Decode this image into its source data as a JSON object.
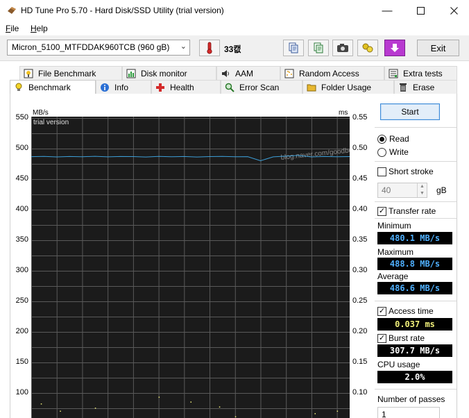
{
  "window": {
    "title": "HD Tune Pro 5.70 - Hard Disk/SSD Utility (trial version)"
  },
  "menu": {
    "file_rest": "ile",
    "help_rest": "elp",
    "file_mn": "F",
    "help_mn": "H"
  },
  "toolbar": {
    "drive": "Micron_5100_MTFDDAK960TCB (960 gB)",
    "temperature": "33캢",
    "exit_label": "Exit"
  },
  "tabs": {
    "top": [
      "File Benchmark",
      "Disk monitor",
      "AAM",
      "Random Access",
      "Extra tests"
    ],
    "bottom": [
      "Benchmark",
      "Info",
      "Health",
      "Error Scan",
      "Folder Usage",
      "Erase"
    ],
    "active": "Benchmark"
  },
  "panel": {
    "start_label": "Start",
    "read_label": "Read",
    "write_label": "Write",
    "mode_selected": "Read",
    "short_stroke_label": "Short stroke",
    "short_stroke_checked": false,
    "short_stroke_value": "40",
    "short_stroke_unit": "gB",
    "transfer_rate_label": "Transfer rate",
    "transfer_rate_checked": true,
    "minimum_label": "Minimum",
    "minimum_value": "480.1 MB/s",
    "maximum_label": "Maximum",
    "maximum_value": "488.8 MB/s",
    "average_label": "Average",
    "average_value": "486.6 MB/s",
    "access_time_label": "Access time",
    "access_time_checked": true,
    "access_time_value": "0.037 ms",
    "burst_rate_label": "Burst rate",
    "burst_rate_checked": true,
    "burst_rate_value": "307.7 MB/s",
    "cpu_usage_label": "CPU usage",
    "cpu_usage_value": "2.0%",
    "passes_label": "Number of passes",
    "passes_value": "1"
  },
  "colors": {
    "plot_bg": "#1b1b1b",
    "grid": "#5a5a5a",
    "transfer_line": "#3d9fd8",
    "value_blue": "#4fb0ff",
    "value_yellow": "#f0ef7a",
    "value_white": "#ffffff"
  },
  "chart_data": {
    "type": "line",
    "trial_label": "trial version",
    "watermark": "blog.naver.com/goodboy0505",
    "y_left_unit": "MB/s",
    "y_right_unit": "ms",
    "y_left_ticks": [
      550,
      500,
      450,
      400,
      350,
      300,
      250,
      200,
      150,
      100
    ],
    "y_right_ticks": [
      "0.55",
      "0.50",
      "0.45",
      "0.40",
      "0.35",
      "0.30",
      "0.25",
      "0.20",
      "0.15",
      "0.10"
    ],
    "ylim_left": [
      0,
      550
    ],
    "ylim_right": [
      0,
      0.55
    ],
    "grid": true,
    "series": [
      {
        "name": "Transfer rate",
        "x": [
          0,
          4,
          8,
          12,
          16,
          20,
          24,
          28,
          32,
          36,
          40,
          44,
          48,
          52,
          56,
          60,
          64,
          68,
          72,
          76,
          80,
          84,
          88,
          92,
          96,
          100
        ],
        "values": [
          486.8,
          487.2,
          486.4,
          487.0,
          486.6,
          487.4,
          486.5,
          487.1,
          486.9,
          486.3,
          487.3,
          486.7,
          487.0,
          486.2,
          486.9,
          487.2,
          486.6,
          486.8,
          480.1,
          486.5,
          487.6,
          488.8,
          486.4,
          487.0,
          486.6,
          486.9
        ]
      },
      {
        "name": "Access time",
        "x": [
          3,
          9,
          20,
          23,
          24,
          33,
          39,
          40,
          47,
          49,
          50,
          59,
          64,
          70,
          82,
          89,
          96
        ],
        "values": [
          0.083,
          0.071,
          0.076,
          0.054,
          0.048,
          0.058,
          0.051,
          0.094,
          0.049,
          0.056,
          0.086,
          0.078,
          0.062,
          0.052,
          0.058,
          0.067,
          0.071
        ]
      }
    ]
  }
}
